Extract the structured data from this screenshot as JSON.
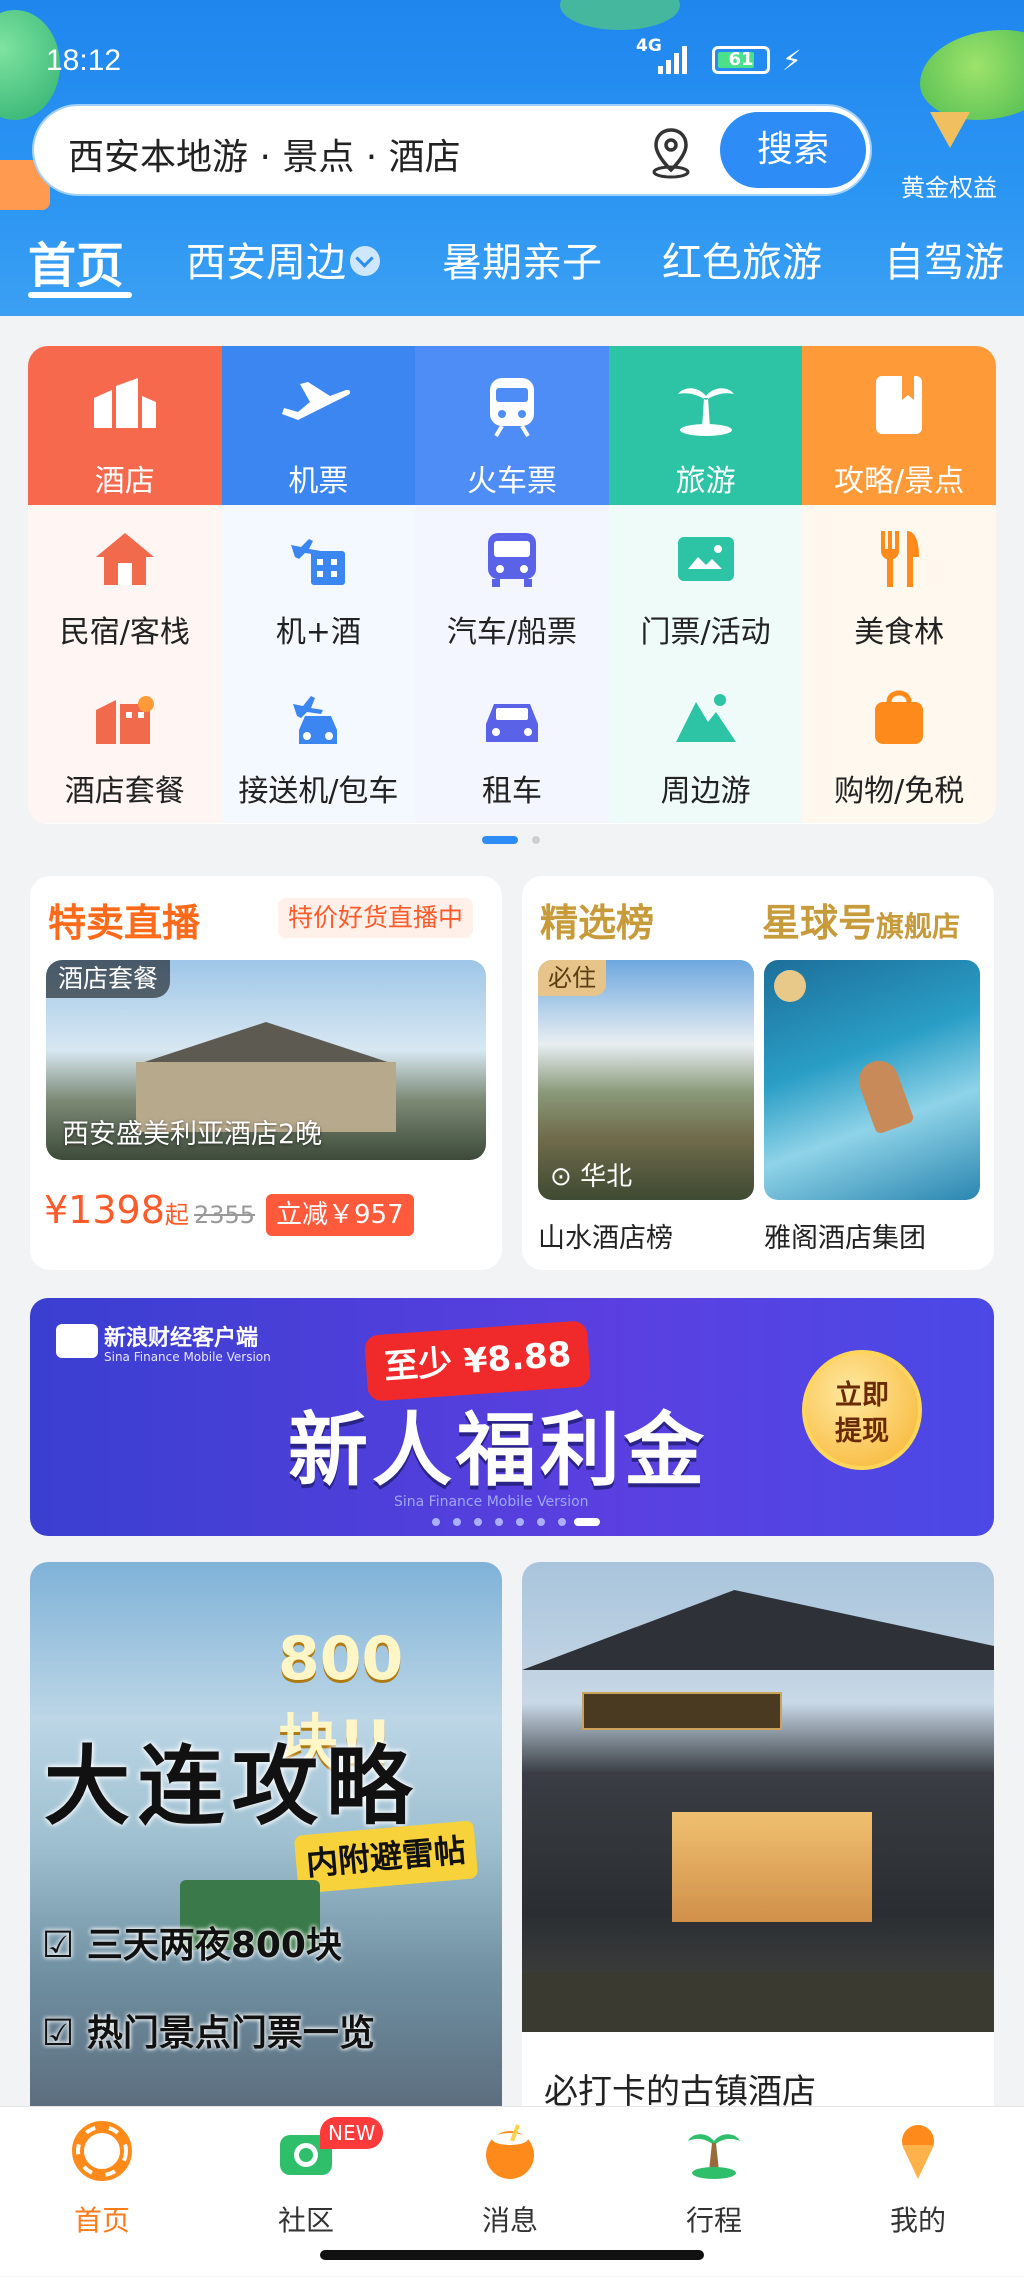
{
  "status": {
    "time": "18:12",
    "network": "4G",
    "battery": "61"
  },
  "search": {
    "text": "西安本地游 · 景点 · 酒店",
    "button": "搜索"
  },
  "vip": {
    "label": "黄金权益"
  },
  "tabs": [
    "首页",
    "西安周边",
    "暑期亲子",
    "红色旅游",
    "自驾游"
  ],
  "grid": {
    "row1": [
      "酒店",
      "机票",
      "火车票",
      "旅游",
      "攻略/景点"
    ],
    "row2": [
      "民宿/客栈",
      "机+酒",
      "汽车/船票",
      "门票/活动",
      "美食林"
    ],
    "row3": [
      "酒店套餐",
      "接送机/包车",
      "租车",
      "周边游",
      "购物/免税"
    ]
  },
  "live": {
    "title": "特卖直播",
    "tag": "特价好货直播中",
    "badge": "酒店套餐",
    "hotel": "西安盛美利亚酒店2晚",
    "price": "¥1398",
    "price_suffix": "起",
    "orig_price": "2355",
    "discount": "立减￥957"
  },
  "rank": {
    "title": "精选榜",
    "brand_title": "星球号",
    "brand_suffix": "旗舰店",
    "badge": "必住",
    "region": "华北",
    "label1": "山水酒店榜",
    "label2": "雅阁酒店集团"
  },
  "banner": {
    "brand": "新浪财经客户端",
    "brand_en": "Sina Finance Mobile Version",
    "tag": "至少 ¥8.88",
    "headline": "新人福利金",
    "sub": "Sina Finance Mobile Version",
    "cta": "立即提现"
  },
  "feed": {
    "left": {
      "amount": "800块!!",
      "title": "大连攻略",
      "tag": "内附避雷帖",
      "item1": "三天两夜800块",
      "item2": "热门景点门票一览"
    },
    "right": {
      "caption": "必打卡的古镇酒店"
    }
  },
  "nav": [
    {
      "label": "首页",
      "icon": "home-ring-icon"
    },
    {
      "label": "社区",
      "icon": "camera-icon",
      "badge": "NEW"
    },
    {
      "label": "消息",
      "icon": "coconut-icon"
    },
    {
      "label": "行程",
      "icon": "palm-tree-icon"
    },
    {
      "label": "我的",
      "icon": "ice-cream-icon"
    }
  ],
  "colors": {
    "primary": "#2d8cf5",
    "hotel": "#f66b4c",
    "flight": "#3b86f0",
    "train": "#4e8df5",
    "travel": "#2dc3a5",
    "guide": "#ff9a38",
    "price": "#ff5a2a"
  }
}
